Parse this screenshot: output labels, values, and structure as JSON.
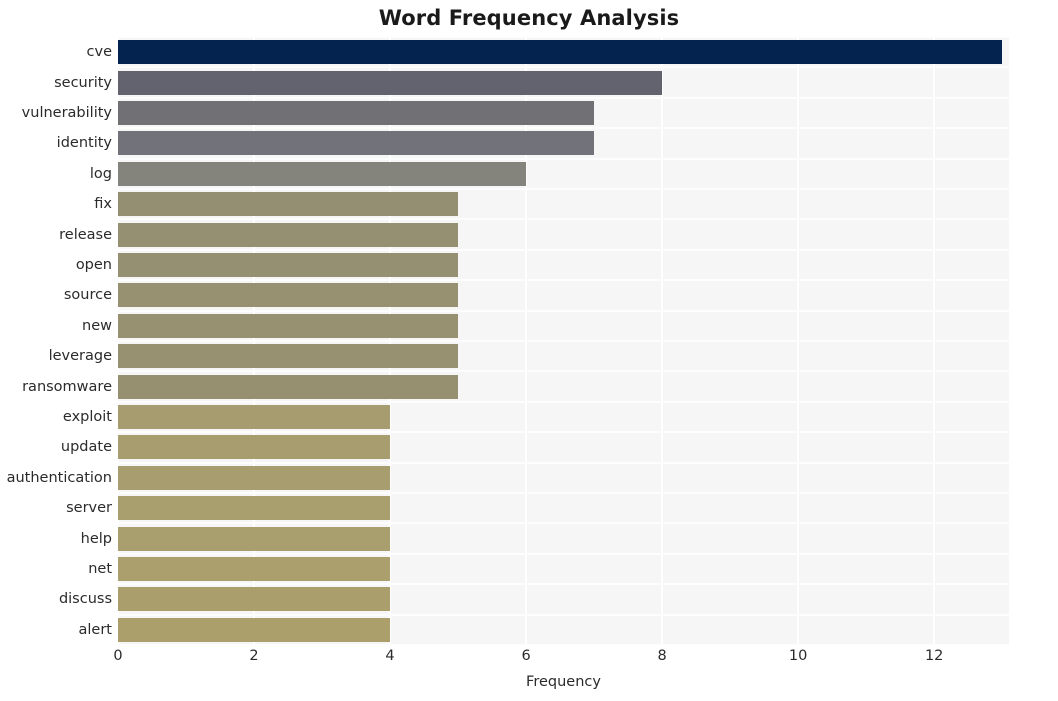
{
  "chart_data": {
    "type": "bar",
    "orientation": "horizontal",
    "title": "Word Frequency Analysis",
    "xlabel": "Frequency",
    "ylabel": "",
    "categories": [
      "cve",
      "security",
      "vulnerability",
      "identity",
      "log",
      "fix",
      "release",
      "open",
      "source",
      "new",
      "leverage",
      "ransomware",
      "exploit",
      "update",
      "authentication",
      "server",
      "help",
      "net",
      "discuss",
      "alert"
    ],
    "values": [
      13,
      8,
      7,
      7,
      6,
      5,
      5,
      5,
      5,
      5,
      5,
      5,
      4,
      4,
      4,
      4,
      4,
      4,
      4,
      4
    ],
    "bar_colors": [
      "#04234f",
      "#63636f",
      "#717175",
      "#72727a",
      "#84837c",
      "#948e73",
      "#969073",
      "#969072",
      "#979172",
      "#979171",
      "#989171",
      "#969070",
      "#a79c6f",
      "#a89d6e",
      "#a89d6e",
      "#a99e6d",
      "#a99e6d",
      "#aa9f6d",
      "#aa9f6c",
      "#ab9f6c"
    ],
    "xlim": [
      0,
      13.1
    ],
    "xticks": [
      0,
      2,
      4,
      6,
      8,
      10,
      12
    ],
    "xticklabels": [
      "0",
      "2",
      "4",
      "6",
      "8",
      "10",
      "12"
    ],
    "grid": true,
    "grid_color": "#ffffff",
    "plot_background": "#f6f6f7",
    "figure_background": "#ffffff",
    "legend": null
  }
}
